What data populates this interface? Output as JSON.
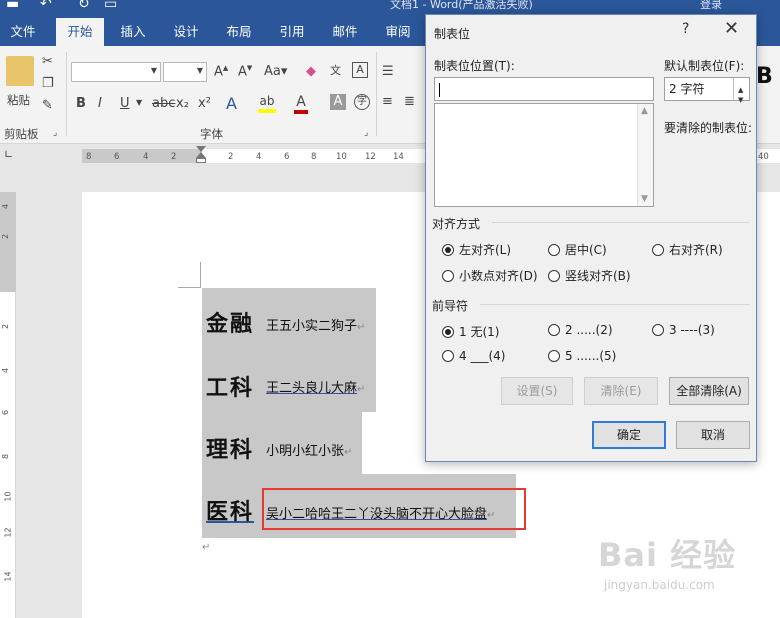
{
  "titlebar": {
    "title": "文档1 - Word(产品激活失败)",
    "user": "登录"
  },
  "menubar": {
    "tabs": [
      "文件",
      "开始",
      "插入",
      "设计",
      "布局",
      "引用",
      "邮件",
      "审阅"
    ]
  },
  "ribbon": {
    "paste_label": "粘贴",
    "clipboard_label": "剪贴板",
    "font_label": "字体",
    "font_name": "",
    "font_size": "",
    "font_color": "#c00000",
    "highlight_color": "#ffff00",
    "style_preview": "B"
  },
  "ruler": {
    "h_ticks": [
      "8",
      "6",
      "4",
      "2",
      "2",
      "4",
      "6",
      "8",
      "10",
      "12",
      "14"
    ],
    "h_right": "40",
    "v_ticks": [
      "4",
      "2",
      "2",
      "4",
      "6",
      "8",
      "10",
      "12",
      "14"
    ]
  },
  "document": {
    "rows": [
      {
        "big": "金融",
        "text": "王五小实二狗子"
      },
      {
        "big": "工科",
        "text": "王二头良儿大麻"
      },
      {
        "big": "理科",
        "text": "小明小红小张"
      },
      {
        "big": "医科",
        "text": "吴小二哈哈王二丫没头脑不开心大脸盘"
      }
    ],
    "para_mark": "↵"
  },
  "dialog": {
    "title": "制表位",
    "help": "?",
    "tab_position_label": "制表位位置(T):",
    "tab_position_value": "",
    "default_tab_label": "默认制表位(F):",
    "default_tab_value": "2 字符",
    "clear_label": "要清除的制表位:",
    "alignment_label": "对齐方式",
    "alignment_options": [
      "左对齐(L)",
      "居中(C)",
      "右对齐(R)",
      "小数点对齐(D)",
      "竖线对齐(B)"
    ],
    "leader_label": "前导符",
    "leader_options": [
      "1 无(1)",
      "2 .....(2)",
      "3 ----(3)",
      "4 ___(4)",
      "5 ......(5)"
    ],
    "set_button": "设置(S)",
    "clear_button": "清除(E)",
    "clear_all_button": "全部清除(A)",
    "ok_button": "确定",
    "cancel_button": "取消"
  },
  "watermark": {
    "text": "Bai 经验",
    "url": "jingyan.baidu.com"
  }
}
